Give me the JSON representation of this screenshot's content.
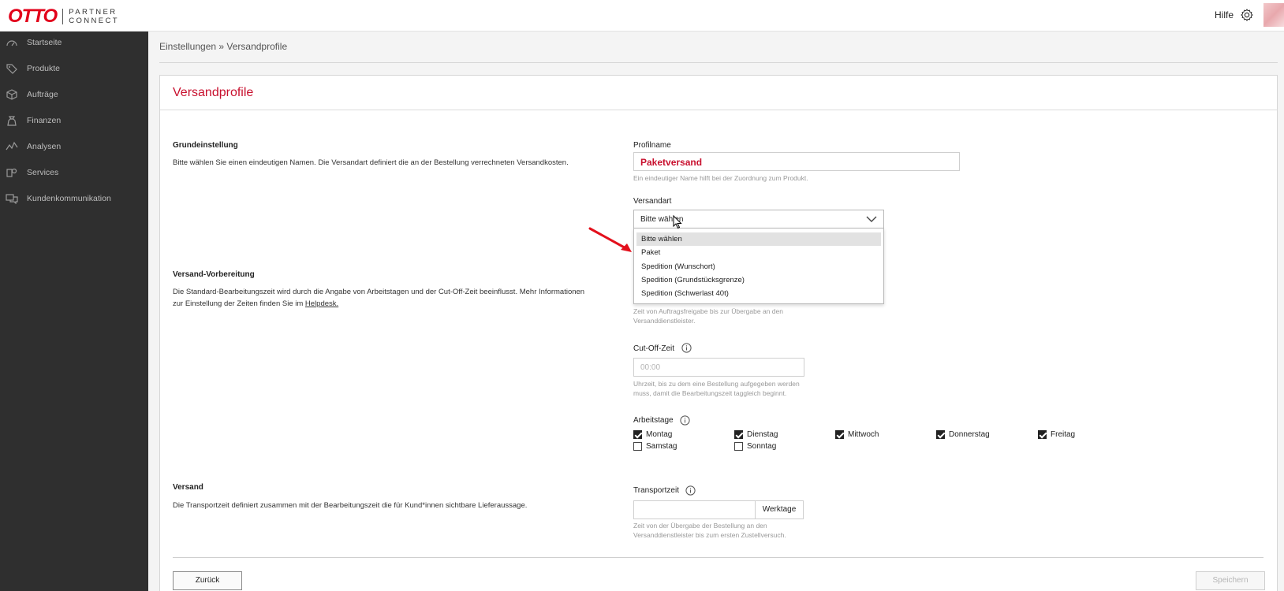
{
  "header": {
    "logo_brand": "OTTO",
    "logo_sub_1": "PARTNER",
    "logo_sub_2": "CONNECT",
    "help_label": "Hilfe",
    "icons": {
      "settings": "gear-icon"
    }
  },
  "sidebar": {
    "items": [
      {
        "label": "Startseite",
        "icon": "dashboard-icon"
      },
      {
        "label": "Produkte",
        "icon": "tag-icon"
      },
      {
        "label": "Aufträge",
        "icon": "box-icon"
      },
      {
        "label": "Finanzen",
        "icon": "money-bag-icon"
      },
      {
        "label": "Analysen",
        "icon": "chart-line-icon"
      },
      {
        "label": "Services",
        "icon": "services-icon"
      },
      {
        "label": "Kundenkommunikation",
        "icon": "chat-icon"
      }
    ]
  },
  "breadcrumb": {
    "text": "Einstellungen » Versandprofile"
  },
  "page": {
    "title": "Versandprofile"
  },
  "sections": {
    "basic": {
      "title": "Grundeinstellung",
      "description": "Bitte wählen Sie einen eindeutigen Namen. Die Versandart definiert die an der Bestellung verrechneten Versandkosten."
    },
    "prep": {
      "title": "Versand-Vorbereitung",
      "description_1": "Die Standard-Bearbeitungszeit wird durch die Angabe von Arbeitstagen und der Cut-Off-Zeit beeinflusst. Mehr Informationen",
      "description_2": "zur Einstellung der Zeiten finden Sie im ",
      "help_link": "Helpdesk."
    },
    "shipping": {
      "title": "Versand",
      "description": "Die Transportzeit definiert zusammen mit der Bearbeitungszeit die für Kund*innen sichtbare Lieferaussage."
    }
  },
  "form": {
    "profile_name": {
      "label": "Profilname",
      "value": "Paketversand",
      "hint": "Ein eindeutiger Name hilft bei der Zuordnung zum Produkt."
    },
    "shipping_type": {
      "label": "Versandart",
      "value": "Bitte wählen",
      "options": [
        "Bitte wählen",
        "Paket",
        "Spedition (Wunschort)",
        "Spedition (Grundstücksgrenze)",
        "Spedition (Schwerlast 40t)"
      ]
    },
    "processing_hint_1": "Zeit von Auftragsfreigabe bis zur Übergabe an den",
    "processing_hint_2": "Versanddienstleister.",
    "cutoff": {
      "label": "Cut-Off-Zeit",
      "placeholder": "00:00",
      "hint_1": "Uhrzeit, bis zu dem eine Bestellung aufgegeben werden",
      "hint_2": "muss, damit die Bearbeitungszeit taggleich beginnt."
    },
    "workdays": {
      "label": "Arbeitstage",
      "days": [
        {
          "label": "Montag",
          "checked": true
        },
        {
          "label": "Dienstag",
          "checked": true
        },
        {
          "label": "Mittwoch",
          "checked": true
        },
        {
          "label": "Donnerstag",
          "checked": true
        },
        {
          "label": "Freitag",
          "checked": true
        },
        {
          "label": "Samstag",
          "checked": false
        },
        {
          "label": "Sonntag",
          "checked": false
        }
      ]
    },
    "transport": {
      "label": "Transportzeit",
      "unit": "Werktage",
      "hint_1": "Zeit von der Übergabe der Bestellung an den",
      "hint_2": "Versanddienstleister bis zum ersten Zustellversuch."
    }
  },
  "actions": {
    "back": "Zurück",
    "save": "Speichern"
  },
  "colors": {
    "brand": "#e2001a",
    "accent_text": "#c8102e",
    "sidebar_bg": "#2f2f2f",
    "annotation_arrow": "#e3101c"
  }
}
